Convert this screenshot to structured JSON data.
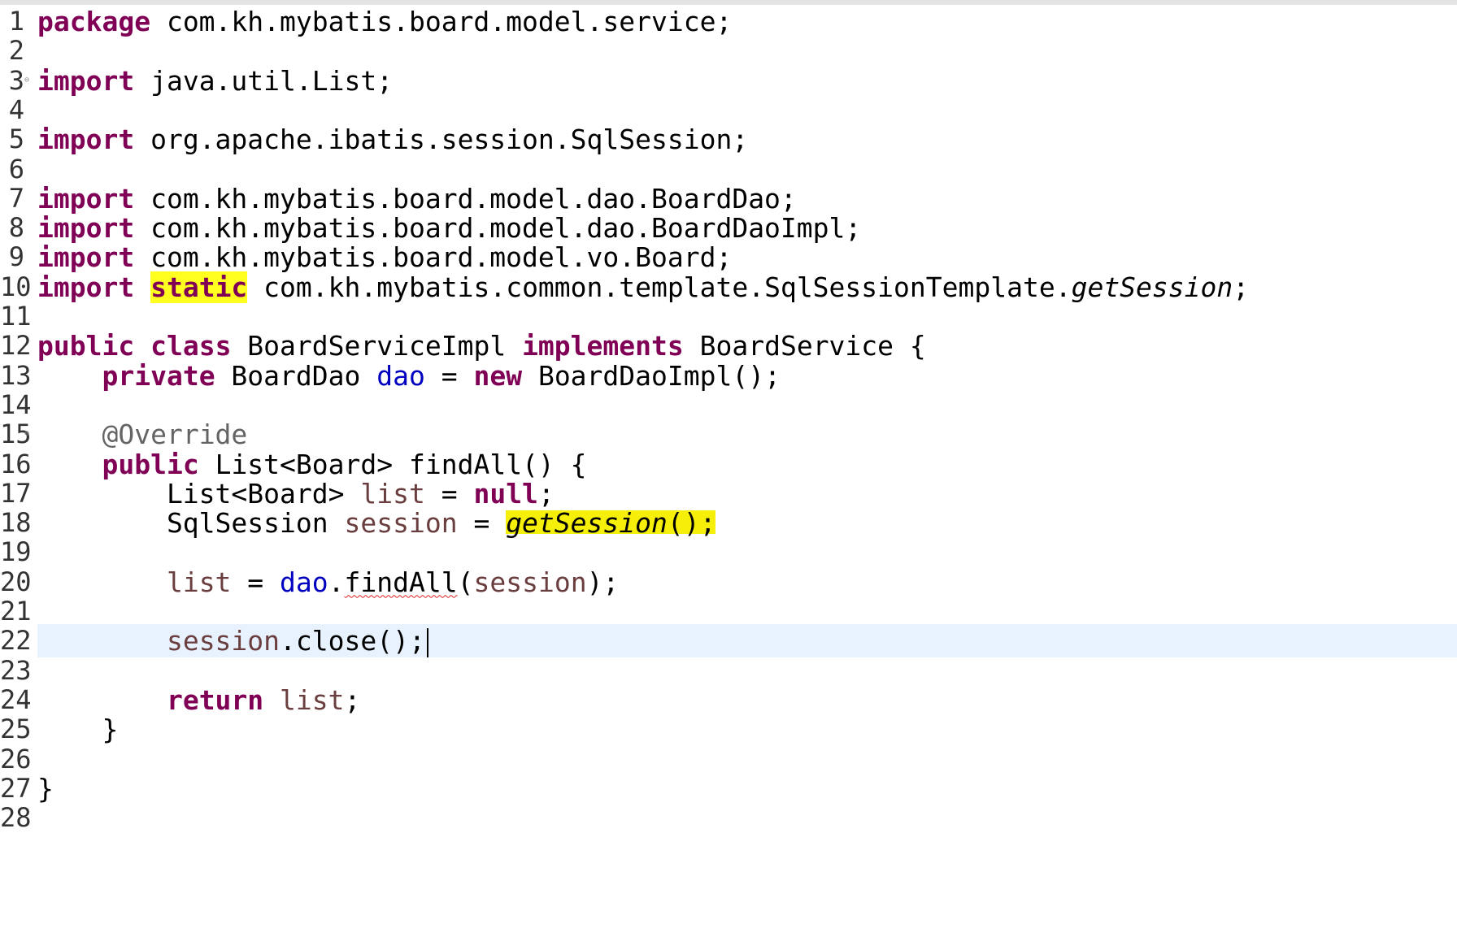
{
  "editor": {
    "current_line": 22,
    "lines": [
      {
        "n": "1",
        "tokens": [
          {
            "t": "kw",
            "v": "package"
          },
          {
            "t": "plain",
            "v": " com.kh.mybatis.board.model.service;"
          }
        ]
      },
      {
        "n": "2",
        "tokens": []
      },
      {
        "n": "3",
        "fold": true,
        "tokens": [
          {
            "t": "kw",
            "v": "import"
          },
          {
            "t": "plain",
            "v": " java.util.List;"
          }
        ]
      },
      {
        "n": "4",
        "tokens": []
      },
      {
        "n": "5",
        "tokens": [
          {
            "t": "kw",
            "v": "import"
          },
          {
            "t": "plain",
            "v": " org.apache.ibatis.session.SqlSession;"
          }
        ]
      },
      {
        "n": "6",
        "tokens": []
      },
      {
        "n": "7",
        "tokens": [
          {
            "t": "kw",
            "v": "import"
          },
          {
            "t": "plain",
            "v": " com.kh.mybatis.board.model.dao.BoardDao;"
          }
        ]
      },
      {
        "n": "8",
        "tokens": [
          {
            "t": "kw",
            "v": "import"
          },
          {
            "t": "plain",
            "v": " com.kh.mybatis.board.model.dao.BoardDaoImpl;"
          }
        ]
      },
      {
        "n": "9",
        "tokens": [
          {
            "t": "kw",
            "v": "import"
          },
          {
            "t": "plain",
            "v": " com.kh.mybatis.board.model.vo.Board;"
          }
        ]
      },
      {
        "n": "10",
        "tokens": [
          {
            "t": "kw",
            "v": "import"
          },
          {
            "t": "plain",
            "v": " "
          },
          {
            "t": "kw hl-y",
            "v": "static"
          },
          {
            "t": "plain",
            "v": " com.kh.mybatis.common.template.SqlSessionTemplate."
          },
          {
            "t": "it",
            "v": "getSession"
          },
          {
            "t": "plain",
            "v": ";"
          }
        ]
      },
      {
        "n": "11",
        "tokens": []
      },
      {
        "n": "12",
        "tokens": [
          {
            "t": "kw",
            "v": "public"
          },
          {
            "t": "plain",
            "v": " "
          },
          {
            "t": "kw",
            "v": "class"
          },
          {
            "t": "plain",
            "v": " BoardServiceImpl "
          },
          {
            "t": "kw",
            "v": "implements"
          },
          {
            "t": "plain",
            "v": " BoardService {"
          }
        ]
      },
      {
        "n": "13",
        "tokens": [
          {
            "t": "plain",
            "v": "    "
          },
          {
            "t": "kw",
            "v": "private"
          },
          {
            "t": "plain",
            "v": " BoardDao "
          },
          {
            "t": "field",
            "v": "dao"
          },
          {
            "t": "plain",
            "v": " = "
          },
          {
            "t": "kw",
            "v": "new"
          },
          {
            "t": "plain",
            "v": " BoardDaoImpl();"
          }
        ]
      },
      {
        "n": "14",
        "tokens": []
      },
      {
        "n": "15",
        "fold": true,
        "tokens": [
          {
            "t": "plain",
            "v": "    "
          },
          {
            "t": "ann",
            "v": "@Override"
          }
        ]
      },
      {
        "n": "16",
        "tokens": [
          {
            "t": "plain",
            "v": "    "
          },
          {
            "t": "kw",
            "v": "public"
          },
          {
            "t": "plain",
            "v": " List<Board> findAll() {"
          }
        ]
      },
      {
        "n": "17",
        "tokens": [
          {
            "t": "plain",
            "v": "        List<Board> "
          },
          {
            "t": "var",
            "v": "list"
          },
          {
            "t": "plain",
            "v": " = "
          },
          {
            "t": "kw",
            "v": "null"
          },
          {
            "t": "plain",
            "v": ";"
          }
        ]
      },
      {
        "n": "18",
        "tokens": [
          {
            "t": "plain",
            "v": "        SqlSession "
          },
          {
            "t": "var",
            "v": "session"
          },
          {
            "t": "plain",
            "v": " = "
          },
          {
            "t": "it marker-y",
            "v": "getSession"
          },
          {
            "t": "plain marker-y",
            "v": "();"
          }
        ]
      },
      {
        "n": "19",
        "tokens": []
      },
      {
        "n": "20",
        "tokens": [
          {
            "t": "plain",
            "v": "        "
          },
          {
            "t": "var",
            "v": "list"
          },
          {
            "t": "plain",
            "v": " = "
          },
          {
            "t": "field",
            "v": "dao"
          },
          {
            "t": "plain",
            "v": "."
          },
          {
            "t": "squiggle",
            "v": "findAll"
          },
          {
            "t": "plain",
            "v": "("
          },
          {
            "t": "var",
            "v": "session"
          },
          {
            "t": "plain",
            "v": ");"
          }
        ]
      },
      {
        "n": "21",
        "tokens": []
      },
      {
        "n": "22",
        "caret": true,
        "tokens": [
          {
            "t": "plain",
            "v": "        "
          },
          {
            "t": "var",
            "v": "session"
          },
          {
            "t": "plain",
            "v": ".close();"
          }
        ]
      },
      {
        "n": "23",
        "tokens": []
      },
      {
        "n": "24",
        "tokens": [
          {
            "t": "plain",
            "v": "        "
          },
          {
            "t": "kw",
            "v": "return"
          },
          {
            "t": "plain",
            "v": " "
          },
          {
            "t": "var",
            "v": "list"
          },
          {
            "t": "plain",
            "v": ";"
          }
        ]
      },
      {
        "n": "25",
        "tokens": [
          {
            "t": "plain",
            "v": "    }"
          }
        ]
      },
      {
        "n": "26",
        "tokens": []
      },
      {
        "n": "27",
        "tokens": [
          {
            "t": "plain",
            "v": "}"
          }
        ]
      },
      {
        "n": "28",
        "tokens": []
      }
    ]
  }
}
